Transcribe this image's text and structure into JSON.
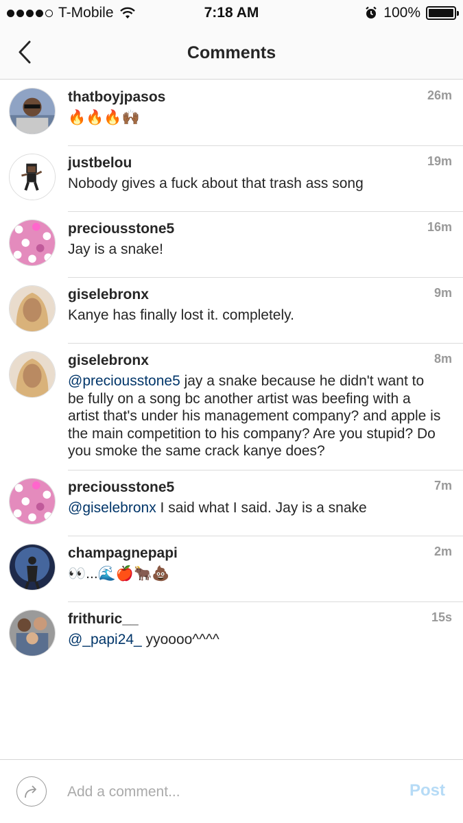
{
  "status_bar": {
    "carrier": "T-Mobile",
    "time": "7:18 AM",
    "battery": "100%",
    "signal_bars": 4,
    "signal_total": 5
  },
  "header": {
    "title": "Comments",
    "back_icon": "chevron-left-icon"
  },
  "comments": [
    {
      "username": "thatboyjpasos",
      "time": "26m",
      "text": "🔥🔥🔥🙌🏾",
      "avatar_color": "#7a8fb0"
    },
    {
      "username": "justbelou",
      "time": "19m",
      "text": "Nobody gives a fuck about that trash ass song",
      "avatar_color": "#ffffff"
    },
    {
      "username": "preciousstone5",
      "time": "16m",
      "text": "Jay is a snake!",
      "avatar_color": "#e58fbf"
    },
    {
      "username": "giselebronx",
      "time": "9m",
      "text": "Kanye has finally lost it. completely.",
      "avatar_color": "#d8b48a"
    },
    {
      "username": "giselebronx",
      "time": "8m",
      "mention": "@preciousstone5",
      "text": " jay a snake because he didn't want to be fully on a song bc another artist was beefing with a artist that's under his management company? and apple is the main competition to his company? Are you stupid? Do you smoke the same crack kanye does?",
      "avatar_color": "#d8b48a"
    },
    {
      "username": "preciousstone5",
      "time": "7m",
      "mention": "@giselebronx",
      "text": " I said what I said. Jay is a snake",
      "avatar_color": "#e58fbf"
    },
    {
      "username": "champagnepapi",
      "time": "2m",
      "text": "👀...🌊🍎🐂💩",
      "avatar_color": "#2b3e6b"
    },
    {
      "username": "frithuric__",
      "time": "15s",
      "mention": "@_papi24_",
      "text": " yyoooo^^^^",
      "avatar_color": "#8a8a8a"
    }
  ],
  "composer": {
    "placeholder": "Add a comment...",
    "post_label": "Post",
    "share_icon": "share-arrow-icon"
  },
  "colors": {
    "mention": "#003569",
    "post_disabled": "#b6dbf6",
    "time": "#999999"
  }
}
